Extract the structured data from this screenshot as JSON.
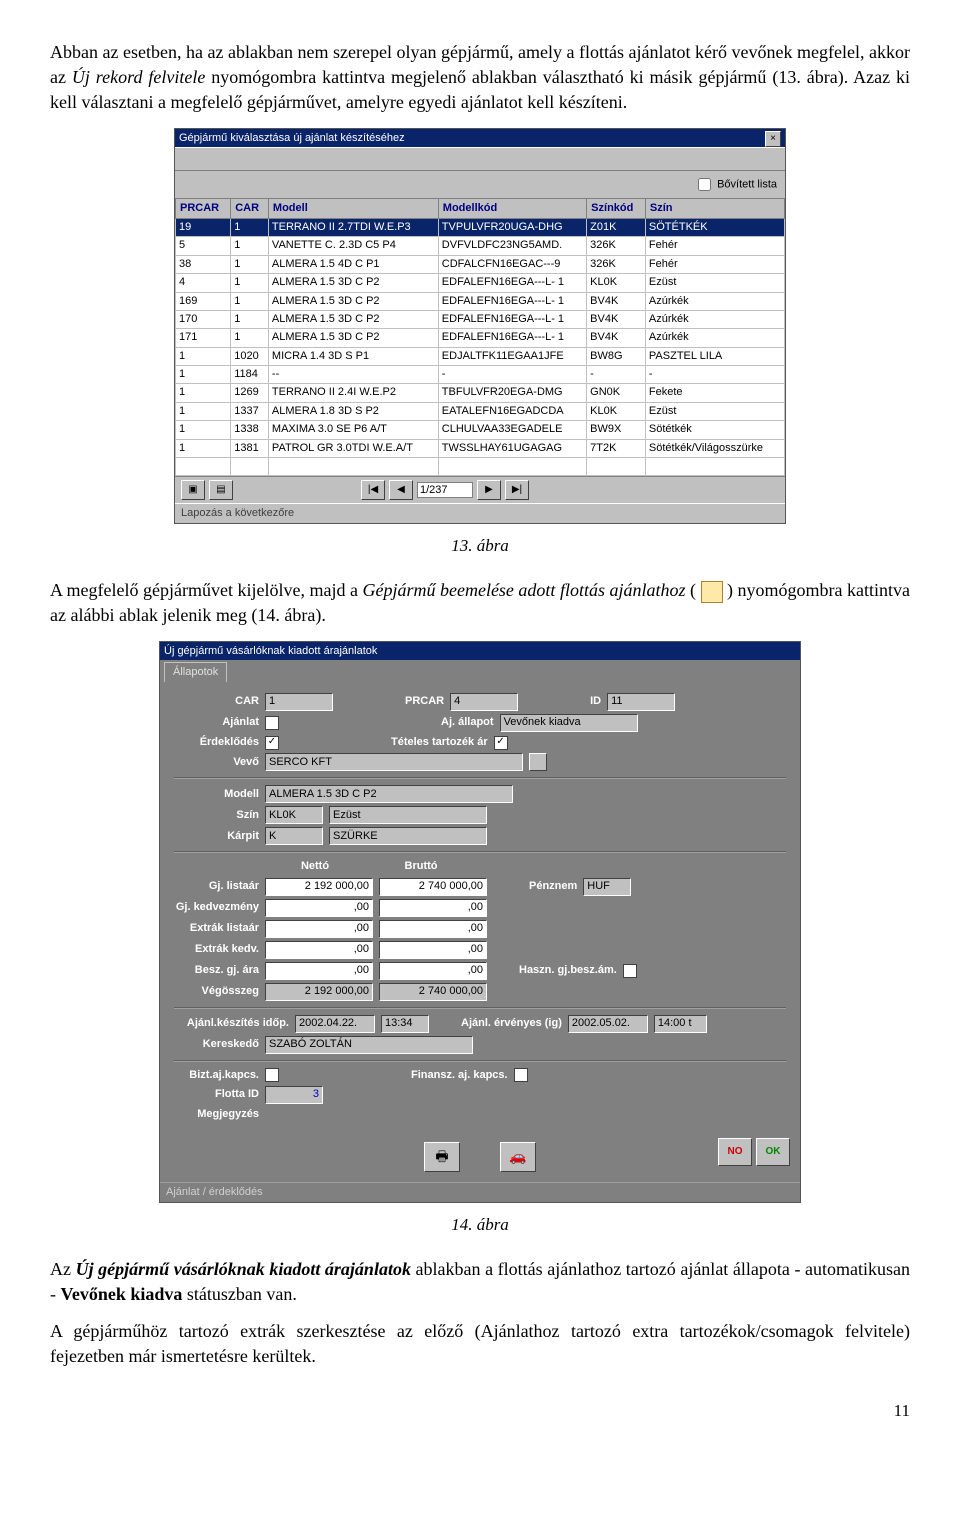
{
  "para1_a": "Abban az esetben, ha az ablakban nem szerepel olyan gépjármű, amely a flottás ajánlatot kérő vevőnek megfelel, akkor az ",
  "para1_i": "Új rekord felvitele",
  "para1_b": " nyomógombra kattintva megjelenő ablakban választható ki másik gépjármű (13. ábra). Azaz ki kell választani a megfelelő gépjárművet, amelyre egyedi ajánlatot kell készíteni.",
  "caption1": "13. ábra",
  "para2_a": "A megfelelő gépjárművet kijelölve, majd a ",
  "para2_i": "Gépjármű beemelése adott flottás ajánlathoz",
  "para2_b": " ( ",
  "para2_c": " ) nyomógombra kattintva az alábbi ablak jelenik meg (14. ábra).",
  "caption2": "14. ábra",
  "para3_a": "Az ",
  "para3_bi": "Új gépjármű vásárlóknak kiadott árajánlatok",
  "para3_b": " ablakban a flottás ajánlathoz tartozó ajánlat állapota - automatikusan - ",
  "para3_bo": "Vevőnek kiadva",
  "para3_c": " státuszban van.",
  "para4": "A gépjárműhöz tartozó extrák szerkesztése az előző (Ajánlathoz tartozó extra tartozékok/csomagok felvitele) fejezetben már ismertetésre kerültek.",
  "pagenum": "11",
  "shot1": {
    "title": "Gépjármű kiválasztása új ajánlat készítéséhez",
    "bovitett": "Bővített lista",
    "headers": [
      "PRCAR",
      "CAR",
      "Modell",
      "Modellkód",
      "Színkód",
      "Szín"
    ],
    "rows": [
      [
        "19",
        "1",
        "TERRANO II 2.7TDI W.E.P3",
        "TVPULVFR20UGA-DHG",
        "Z01K",
        "SÖTÉTKÉK"
      ],
      [
        "5",
        "1",
        "VANETTE C. 2.3D C5 P4",
        "DVFVLDFC23NG5AMD.",
        "326K",
        "Fehér"
      ],
      [
        "38",
        "1",
        "ALMERA 1.5 4D C P1",
        "CDFALCFN16EGAC---9",
        "326K",
        "Fehér"
      ],
      [
        "4",
        "1",
        "ALMERA 1.5 3D C P2",
        "EDFALEFN16EGA---L- 1",
        "KL0K",
        "Ezüst"
      ],
      [
        "169",
        "1",
        "ALMERA 1.5 3D C P2",
        "EDFALEFN16EGA---L- 1",
        "BV4K",
        "Azúrkék"
      ],
      [
        "170",
        "1",
        "ALMERA 1.5 3D C P2",
        "EDFALEFN16EGA---L- 1",
        "BV4K",
        "Azúrkék"
      ],
      [
        "171",
        "1",
        "ALMERA 1.5 3D C P2",
        "EDFALEFN16EGA---L- 1",
        "BV4K",
        "Azúrkék"
      ],
      [
        "1",
        "1020",
        "MICRA 1.4 3D S P1",
        "EDJALTFK11EGAA1JFE",
        "BW8G",
        "PASZTEL LILA"
      ],
      [
        "1",
        "1184",
        "--",
        "-",
        "-",
        "-"
      ],
      [
        "1",
        "1269",
        "TERRANO II 2.4I W.E.P2",
        "TBFULVFR20EGA-DMG",
        "GN0K",
        "Fekete"
      ],
      [
        "1",
        "1337",
        "ALMERA 1.8 3D S P2",
        "EATALEFN16EGADCDA",
        "KL0K",
        "Ezüst"
      ],
      [
        "1",
        "1338",
        "MAXIMA 3.0 SE P6 A/T",
        "CLHULVAA33EGADELE",
        "BW9X",
        "Sötétkék"
      ],
      [
        "1",
        "1381",
        "PATROL GR 3.0TDI W.E.A/T",
        "TWSSLHAY61UGAGAG",
        "7T2K",
        "Sötétkék/Világosszürke"
      ]
    ],
    "pager": "1/237",
    "status": "Lapozás a következőre"
  },
  "shot2": {
    "title": "Új gépjármű vásárlóknak kiadott árajánlatok",
    "tab": "Állapotok",
    "lab_car": "CAR",
    "val_car": "1",
    "lab_prcar": "PRCAR",
    "val_prcar": "4",
    "lab_id": "ID",
    "val_id": "11",
    "lab_ajanlat": "Ajánlat",
    "lab_erdeklodes": "Érdeklődés",
    "lab_allapot": "Aj. állapot",
    "val_allapot": "Vevőnek kiadva",
    "lab_teteles": "Tételes tartozék ár",
    "lab_vevo": "Vevő",
    "val_vevo": "SERCO KFT",
    "lab_modell": "Modell",
    "val_modell": "ALMERA 1.5 3D C P2",
    "lab_szin": "Szín",
    "val_szin1": "KL0K",
    "val_szin2": "Ezüst",
    "lab_karpit": "Kárpit",
    "val_karpit1": "K",
    "val_karpit2": "SZÜRKE",
    "col_netto": "Nettó",
    "col_brutto": "Bruttó",
    "lab_gjlist": "Gj. listaár",
    "lab_gjkedv": "Gj. kedvezmény",
    "lab_extlist": "Extrák listaár",
    "lab_extkedv": "Extrák kedv.",
    "lab_besz": "Besz. gj. ára",
    "lab_veg": "Végösszeg",
    "netto": [
      "2 192 000,00",
      ",00",
      ",00",
      ",00",
      ",00",
      "2 192 000,00"
    ],
    "brutto": [
      "2 740 000,00",
      ",00",
      ",00",
      ",00",
      ",00",
      "2 740 000,00"
    ],
    "lab_penznem": "Pénznem",
    "val_penznem": "HUF",
    "lab_haszn": "Haszn. gj.besz.ám.",
    "lab_keszites": "Ajánl.készítés időp.",
    "val_keszd": "2002.04.22.",
    "val_keszt": "13:34",
    "lab_ervenyes": "Ajánl. érvényes (ig)",
    "val_ervd": "2002.05.02.",
    "val_ervt": "14:00 t",
    "lab_keresk": "Kereskedő",
    "val_keresk": "SZABÓ ZOLTÁN",
    "lab_bizt": "Bizt.aj.kapcs.",
    "lab_finansz": "Finansz. aj. kapcs.",
    "lab_flotta": "Flotta ID",
    "val_flotta": "3",
    "lab_megj": "Megjegyzés",
    "status": "Ajánlat / érdeklődés",
    "no": "NO",
    "ok": "OK"
  }
}
